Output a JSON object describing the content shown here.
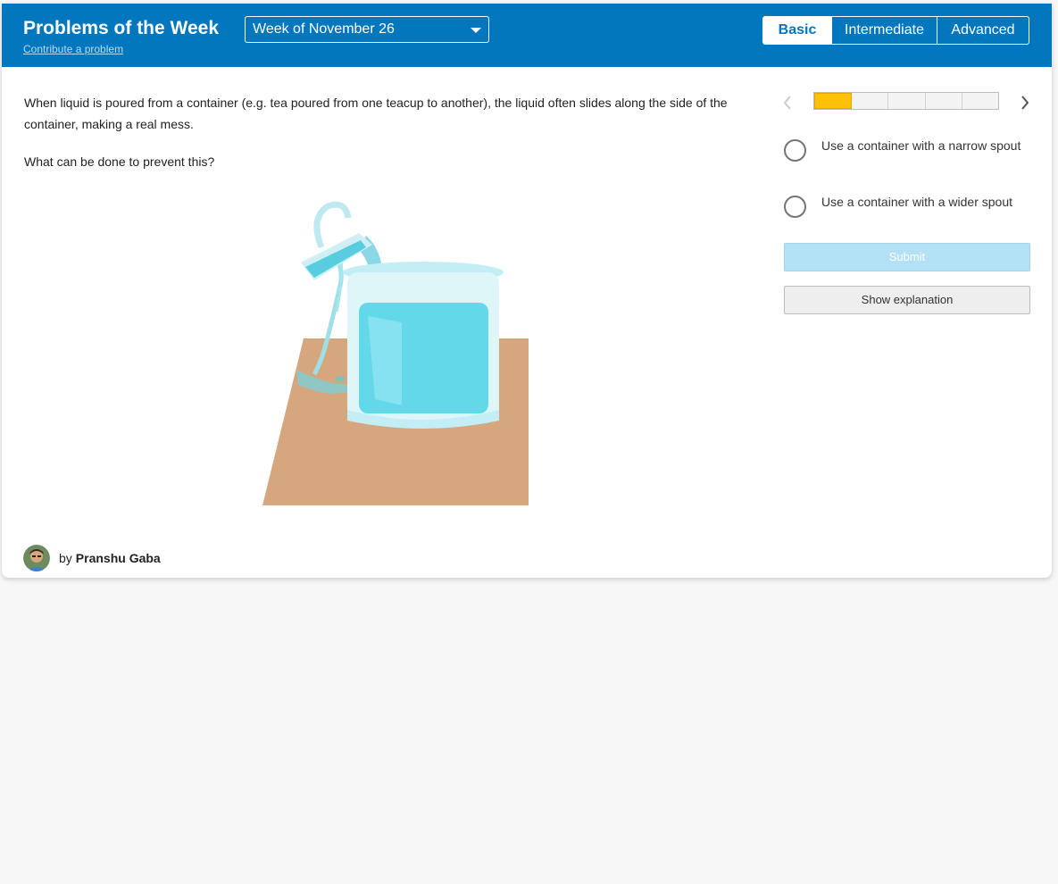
{
  "header": {
    "title": "Problems of the Week",
    "contribute_link": "Contribute a problem",
    "week_selected": "Week of November 26",
    "levels": [
      {
        "label": "Basic",
        "active": true
      },
      {
        "label": "Intermediate",
        "active": false
      },
      {
        "label": "Advanced",
        "active": false
      }
    ]
  },
  "problem": {
    "text": "When liquid is poured from a container (e.g. tea poured from one teacup to another), the liquid often slides along the side of the container, making a real mess.",
    "prompt": "What can be done to prevent this?"
  },
  "author": {
    "prefix": "by",
    "name": "Pranshu Gaba"
  },
  "sidebar": {
    "progress": {
      "current": 1,
      "total": 5
    },
    "options": [
      {
        "label": "Use a container with a narrow spout"
      },
      {
        "label": "Use a container with a wider spout"
      }
    ],
    "submit_label": "Submit",
    "explanation_label": "Show explanation"
  },
  "colors": {
    "header_bg": "#0277bd",
    "progress_fill": "#ffc107",
    "submit_disabled": "#b3e0f5"
  }
}
